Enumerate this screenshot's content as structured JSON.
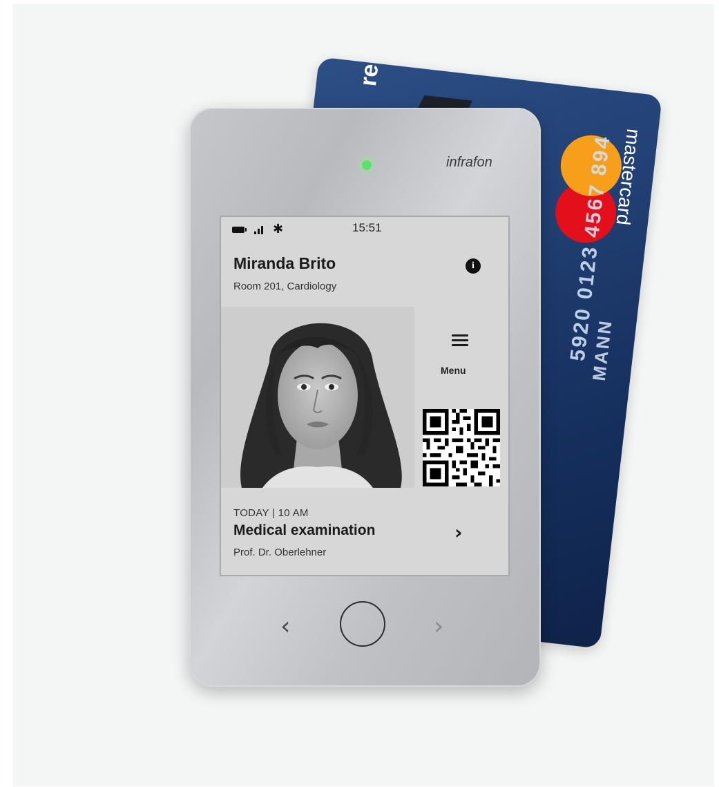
{
  "card": {
    "brand_partial": "re",
    "network": "mastercard",
    "number_partial": "5920 0123 4567 894",
    "holder_partial": "MANN"
  },
  "device": {
    "brand": "infrafon",
    "led_color": "#5fe06a"
  },
  "status_bar": {
    "icons": [
      "battery-icon",
      "signal-icon",
      "bluetooth-icon"
    ],
    "time": "15:51"
  },
  "profile": {
    "name": "Miranda Brito",
    "location": "Room 201, Cardiology",
    "info_icon": "i"
  },
  "menu": {
    "label": "Menu"
  },
  "appointment": {
    "when": "TODAY | 10 AM",
    "title": "Medical examination",
    "doctor": "Prof. Dr. Oberlehner",
    "chevron": "›"
  },
  "navigation": {
    "back": "‹",
    "forward": "›"
  }
}
